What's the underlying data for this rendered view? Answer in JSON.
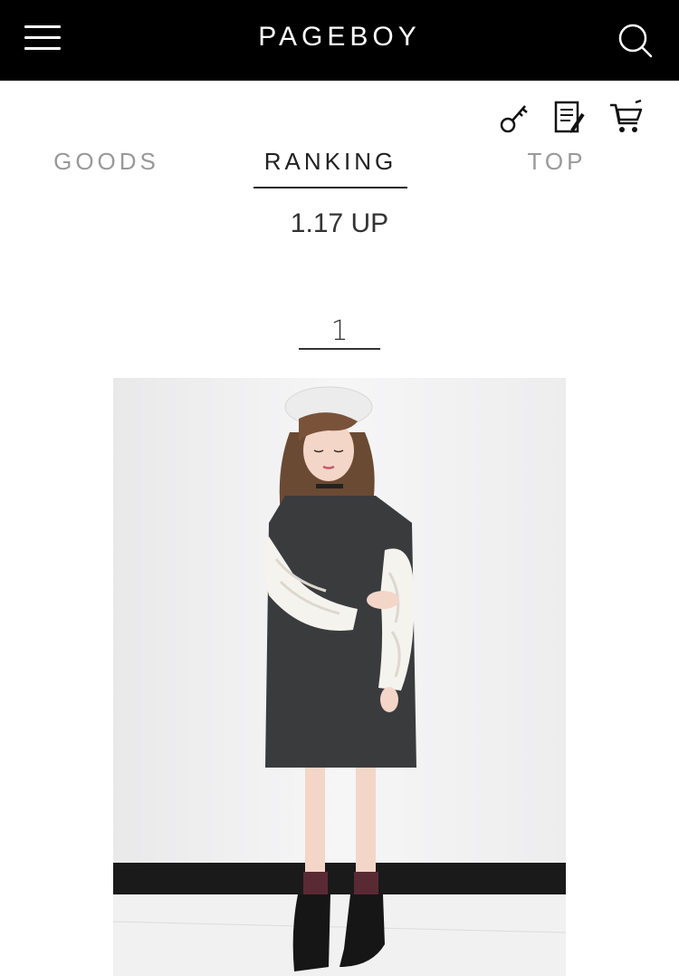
{
  "header": {
    "brand": "PAGEBOY",
    "menu_icon": "hamburger-menu-icon",
    "search_icon": "search-icon"
  },
  "utility_icons": [
    "key-icon",
    "document-pen-icon",
    "cart-icon"
  ],
  "tabs": [
    {
      "label": "GOODS",
      "active": false
    },
    {
      "label": "RANKING",
      "active": true
    },
    {
      "label": "TOP",
      "active": false
    }
  ],
  "update_label": "1.17 UP",
  "ranking": {
    "items": [
      {
        "rank": "1"
      }
    ]
  },
  "colors": {
    "header_bg": "#000000",
    "active_tab": "#222222",
    "inactive_tab": "#999999"
  }
}
